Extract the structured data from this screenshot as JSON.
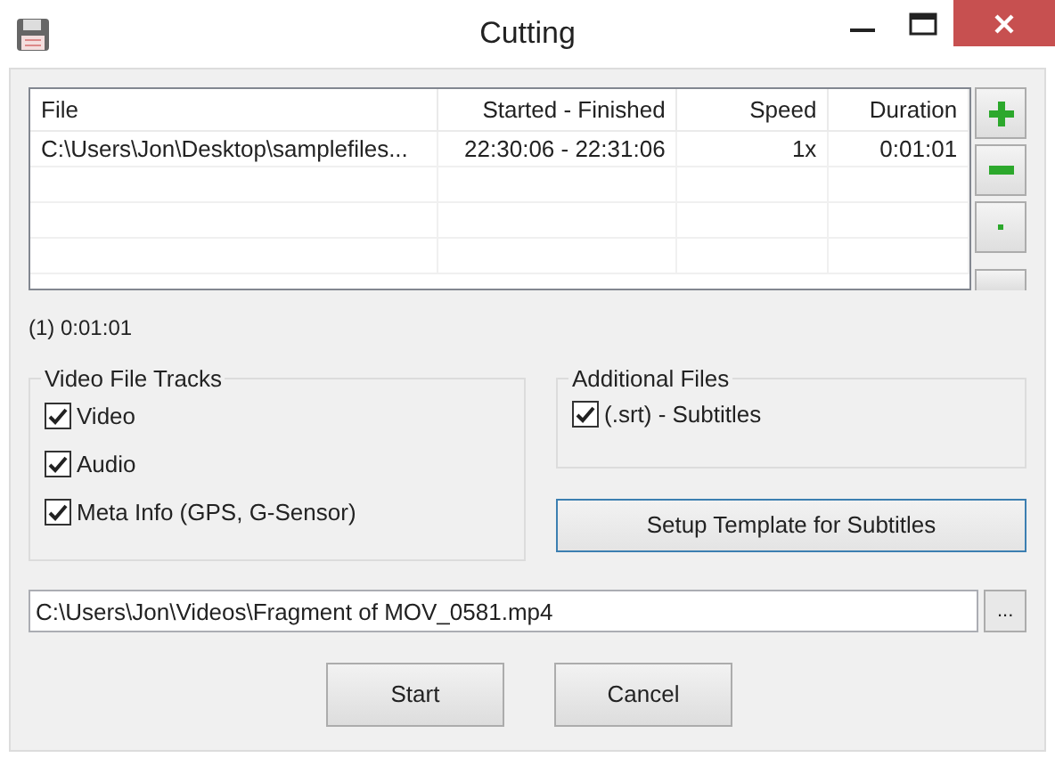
{
  "window": {
    "title": "Cutting"
  },
  "table": {
    "columns": [
      "File",
      "Started - Finished",
      "Speed",
      "Duration"
    ],
    "rows": [
      [
        "C:\\Users\\Jon\\Desktop\\samplefiles...",
        "22:30:06 - 22:31:06",
        "1x",
        "0:01:01"
      ]
    ]
  },
  "side_buttons": [
    {
      "kind": "add"
    },
    {
      "kind": "remove"
    },
    {
      "kind": "dot"
    },
    {
      "kind": "partial"
    }
  ],
  "summary": "(1) 0:01:01",
  "video_tracks": {
    "title": "Video File Tracks",
    "items": [
      {
        "label": "Video",
        "checked": true
      },
      {
        "label": "Audio",
        "checked": true
      },
      {
        "label": "Meta Info (GPS, G-Sensor)",
        "checked": true
      }
    ]
  },
  "additional_files": {
    "title": "Additional Files",
    "items": [
      {
        "label": "(.srt) - Subtitles",
        "checked": true
      }
    ]
  },
  "template_button": "Setup Template for Subtitles",
  "output_path": {
    "value": "C:\\Users\\Jon\\Videos\\Fragment of MOV_0581.mp4",
    "browse": "..."
  },
  "buttons": [
    "Start",
    "Cancel"
  ]
}
